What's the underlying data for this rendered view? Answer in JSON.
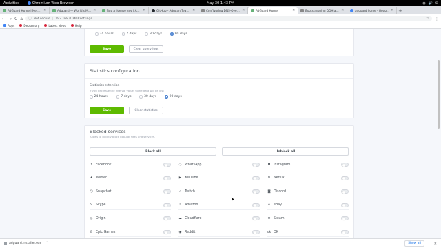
{
  "system": {
    "activities": "Activities",
    "app_name": "Chromium Web Browser",
    "clock": "May 30   1:43 PM",
    "tray": [
      "◉",
      "🔊",
      "⏻"
    ]
  },
  "tabs": [
    {
      "title": "AdGuard Home | Netwo…",
      "icon": "adguard-icon",
      "kind": "ag",
      "active": false
    },
    {
      "title": "Adguard — World's Most…",
      "icon": "adguard-icon",
      "kind": "ag",
      "active": false
    },
    {
      "title": "Buy a license key | Adg…",
      "icon": "adguard-icon",
      "kind": "ag",
      "active": false
    },
    {
      "title": "GitHub - AdguardTeam/…",
      "icon": "github-icon",
      "kind": "gh",
      "active": false
    },
    {
      "title": "Configuring DNS-Over-H…",
      "icon": "document-icon",
      "kind": "doc",
      "active": false
    },
    {
      "title": "AdGuard Home",
      "icon": "adguard-icon",
      "kind": "ag",
      "active": true
    },
    {
      "title": "Bootstrapping DOH and…",
      "icon": "document-icon",
      "kind": "doc",
      "active": false
    },
    {
      "title": "adguard home - Google…",
      "icon": "google-icon",
      "kind": "g",
      "active": false
    }
  ],
  "toolbar": {
    "not_secure": "Not secure",
    "url": "192.168.0.26/#settings",
    "back": "←",
    "forward": "→",
    "reload": "C",
    "home": "⌂",
    "star": "☆",
    "menu": "⋮"
  },
  "bookmarks": [
    {
      "label": "Apps",
      "icon": "apps-grid-icon"
    },
    {
      "label": "Debian.org",
      "icon": "debian-icon"
    },
    {
      "label": "Latest News",
      "icon": "news-icon"
    },
    {
      "label": "Help",
      "icon": "help-icon"
    }
  ],
  "query_log": {
    "radios": [
      {
        "label": "24 hours",
        "checked": false
      },
      {
        "label": "7 days",
        "checked": false
      },
      {
        "label": "30 days",
        "checked": false
      },
      {
        "label": "90 days",
        "checked": true
      }
    ],
    "save": "Save",
    "clear": "Clear query logs"
  },
  "stats": {
    "title": "Statistics configuration",
    "retention_label": "Statistics retention",
    "retention_sub": "If you decrease the interval value, some data will be lost",
    "radios": [
      {
        "label": "24 hours",
        "checked": false
      },
      {
        "label": "7 days",
        "checked": false
      },
      {
        "label": "30 days",
        "checked": false
      },
      {
        "label": "90 days",
        "checked": true
      }
    ],
    "save": "Save",
    "clear": "Clear statistics"
  },
  "blocked": {
    "title": "Blocked services",
    "subtitle": "Allows to quickly block popular sites and services.",
    "block_all": "Block all",
    "unblock_all": "Unblock all",
    "services": [
      {
        "name": "Facebook",
        "icon": "facebook-icon",
        "glyph": "f"
      },
      {
        "name": "WhatsApp",
        "icon": "whatsapp-icon",
        "glyph": "◌"
      },
      {
        "name": "Instagram",
        "icon": "instagram-icon",
        "glyph": "◘"
      },
      {
        "name": "Twitter",
        "icon": "twitter-icon",
        "glyph": "✦"
      },
      {
        "name": "YouTube",
        "icon": "youtube-icon",
        "glyph": "▶"
      },
      {
        "name": "Netflix",
        "icon": "netflix-icon",
        "glyph": "N"
      },
      {
        "name": "Snapchat",
        "icon": "snapchat-icon",
        "glyph": "☺"
      },
      {
        "name": "Twitch",
        "icon": "twitch-icon",
        "glyph": "⌂"
      },
      {
        "name": "Discord",
        "icon": "discord-icon",
        "glyph": "◙"
      },
      {
        "name": "Skype",
        "icon": "skype-icon",
        "glyph": "S"
      },
      {
        "name": "Amazon",
        "icon": "amazon-icon",
        "glyph": "a"
      },
      {
        "name": "eBay",
        "icon": "ebay-icon",
        "glyph": "e"
      },
      {
        "name": "Origin",
        "icon": "origin-icon",
        "glyph": "◎"
      },
      {
        "name": "Cloudflare",
        "icon": "cloudflare-icon",
        "glyph": "☁"
      },
      {
        "name": "Steam",
        "icon": "steam-icon",
        "glyph": "⚙"
      },
      {
        "name": "Epic Games",
        "icon": "epic-games-icon",
        "glyph": "E"
      },
      {
        "name": "Reddit",
        "icon": "reddit-icon",
        "glyph": "◉"
      },
      {
        "name": "OK",
        "icon": "ok-icon",
        "glyph": "ok"
      }
    ]
  },
  "download_bar": {
    "file": "adguard.installer.exe",
    "show_all": "Show all",
    "close": "✕"
  },
  "colors": {
    "accent_green": "#5eba00",
    "accent_blue": "#467fcf"
  }
}
